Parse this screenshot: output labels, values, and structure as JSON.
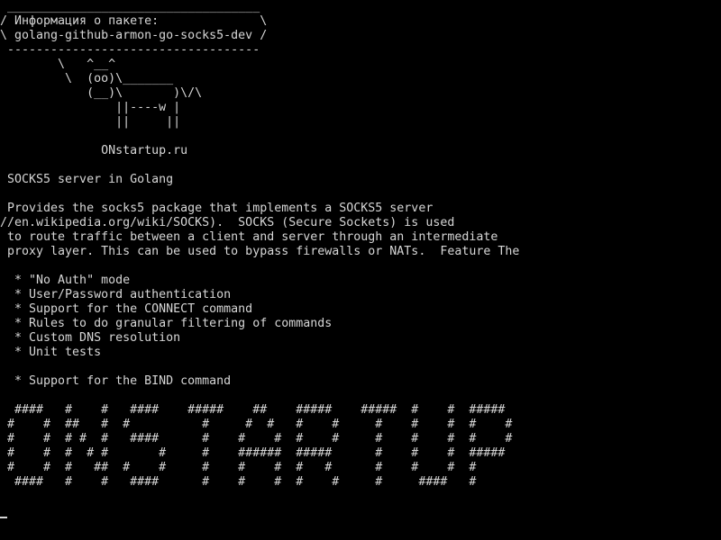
{
  "terminal": {
    "lines": [
      " ___________________________________",
      "/ Информация о пакете:              \\",
      "\\ golang-github-armon-go-socks5-dev /",
      " -----------------------------------",
      "        \\   ^__^",
      "         \\  (oo)\\_______",
      "            (__)\\       )\\/\\",
      "                ||----w |",
      "                ||     ||",
      "",
      "              ONstartup.ru",
      "",
      " SOCKS5 server in Golang",
      "",
      " Provides the socks5 package that implements a SOCKS5 server",
      "//en.wikipedia.org/wiki/SOCKS).  SOCKS (Secure Sockets) is used",
      " to route traffic between a client and server through an intermediate",
      " proxy layer. This can be used to bypass firewalls or NATs.  Feature The",
      "",
      "  * \"No Auth\" mode",
      "  * User/Password authentication",
      "  * Support for the CONNECT command",
      "  * Rules to do granular filtering of commands",
      "  * Custom DNS resolution",
      "  * Unit tests",
      "",
      "  * Support for the BIND command",
      "",
      "  ####   #    #   ####    #####    ##    #####    #####  #    #  #####",
      " #    #  ##   #  #          #     #  #   #    #     #    #    #  #    #",
      " #    #  # #  #   ####      #    #    #  #    #     #    #    #  #    #",
      " #    #  #  # #       #     #    ######  #####      #    #    #  #####",
      " #    #  #   ##  #    #     #    #    #  #   #      #    #    #  #",
      "  ####   #    #   ####      #    #    #  #    #     #     ####   #"
    ]
  }
}
